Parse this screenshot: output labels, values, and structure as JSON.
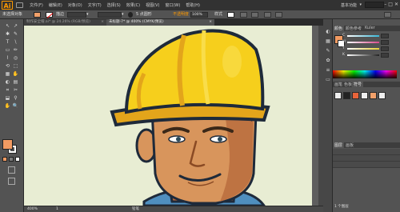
{
  "app": {
    "logo": "Ai",
    "menu": [
      "文件(F)",
      "编辑(E)",
      "对象(O)",
      "文字(T)",
      "选择(S)",
      "效果(C)",
      "视图(V)",
      "窗口(W)",
      "帮助(H)"
    ],
    "workspace": "基本功能",
    "workspace_arrow": "▾",
    "window_controls": [
      "–",
      "□",
      "✕"
    ]
  },
  "control_bar": {
    "selection_label": "未选择对象",
    "stroke_label": "描边",
    "stroke_arrow": "▾",
    "stroke_unit": "▾",
    "brush_label": "点圆形",
    "style_label": "5 点圆形",
    "opacity_label": "不透明度",
    "opacity_value": "100%",
    "style_text": "样式",
    "fill_color": "#f2a16a"
  },
  "tools": {
    "icons": [
      "↖",
      "↗",
      "✱",
      "✎",
      "T",
      "\\",
      "▭",
      "✏",
      "⌇",
      "◎",
      "⟲",
      "⬚",
      "▦",
      "✋",
      "◐",
      "▤",
      "⌗",
      "✂",
      "⬓",
      "⚲",
      "✋",
      "🔍"
    ],
    "fill_color": "#f29b62",
    "stroke_color": "#ffffff"
  },
  "document_tabs": [
    {
      "label": "制作安全帽.ai* @ 24.26% (RGB/预览)",
      "close": "×"
    },
    {
      "label": "未标题-7* @ 400% (CMYK/预览)",
      "close": "×"
    }
  ],
  "status_bar": {
    "zoom": "400%",
    "page": "1",
    "tool_name": "铅笔"
  },
  "panels": {
    "color_tabs": [
      "颜色",
      "颜色参考",
      "Kuler"
    ],
    "color_channels": [
      {
        "label": "C",
        "color": "#39b8d8"
      },
      {
        "label": "M",
        "color": "#d84a8c"
      },
      {
        "label": "Y",
        "color": "#e8d038"
      },
      {
        "label": "K",
        "color": "#7a7a7a"
      }
    ],
    "swatch_tabs": [
      "画笔",
      "色板",
      "符号"
    ],
    "brush_tabs": [
      "图层",
      "画板"
    ],
    "layer_tabs": [
      "图层",
      "画板"
    ],
    "layer_count": "1 个图层",
    "artboards_tab": "画板"
  },
  "colors": {
    "canvas_bg": "#e8edd3",
    "helmet_yellow": "#f6cf1c",
    "helmet_dark": "#e3a51b",
    "outline": "#1e2a3a",
    "skin": "#d8955c",
    "skin_shadow": "#b86a3c",
    "hair": "#6b4a32",
    "shirt": "#4f8fbf"
  }
}
